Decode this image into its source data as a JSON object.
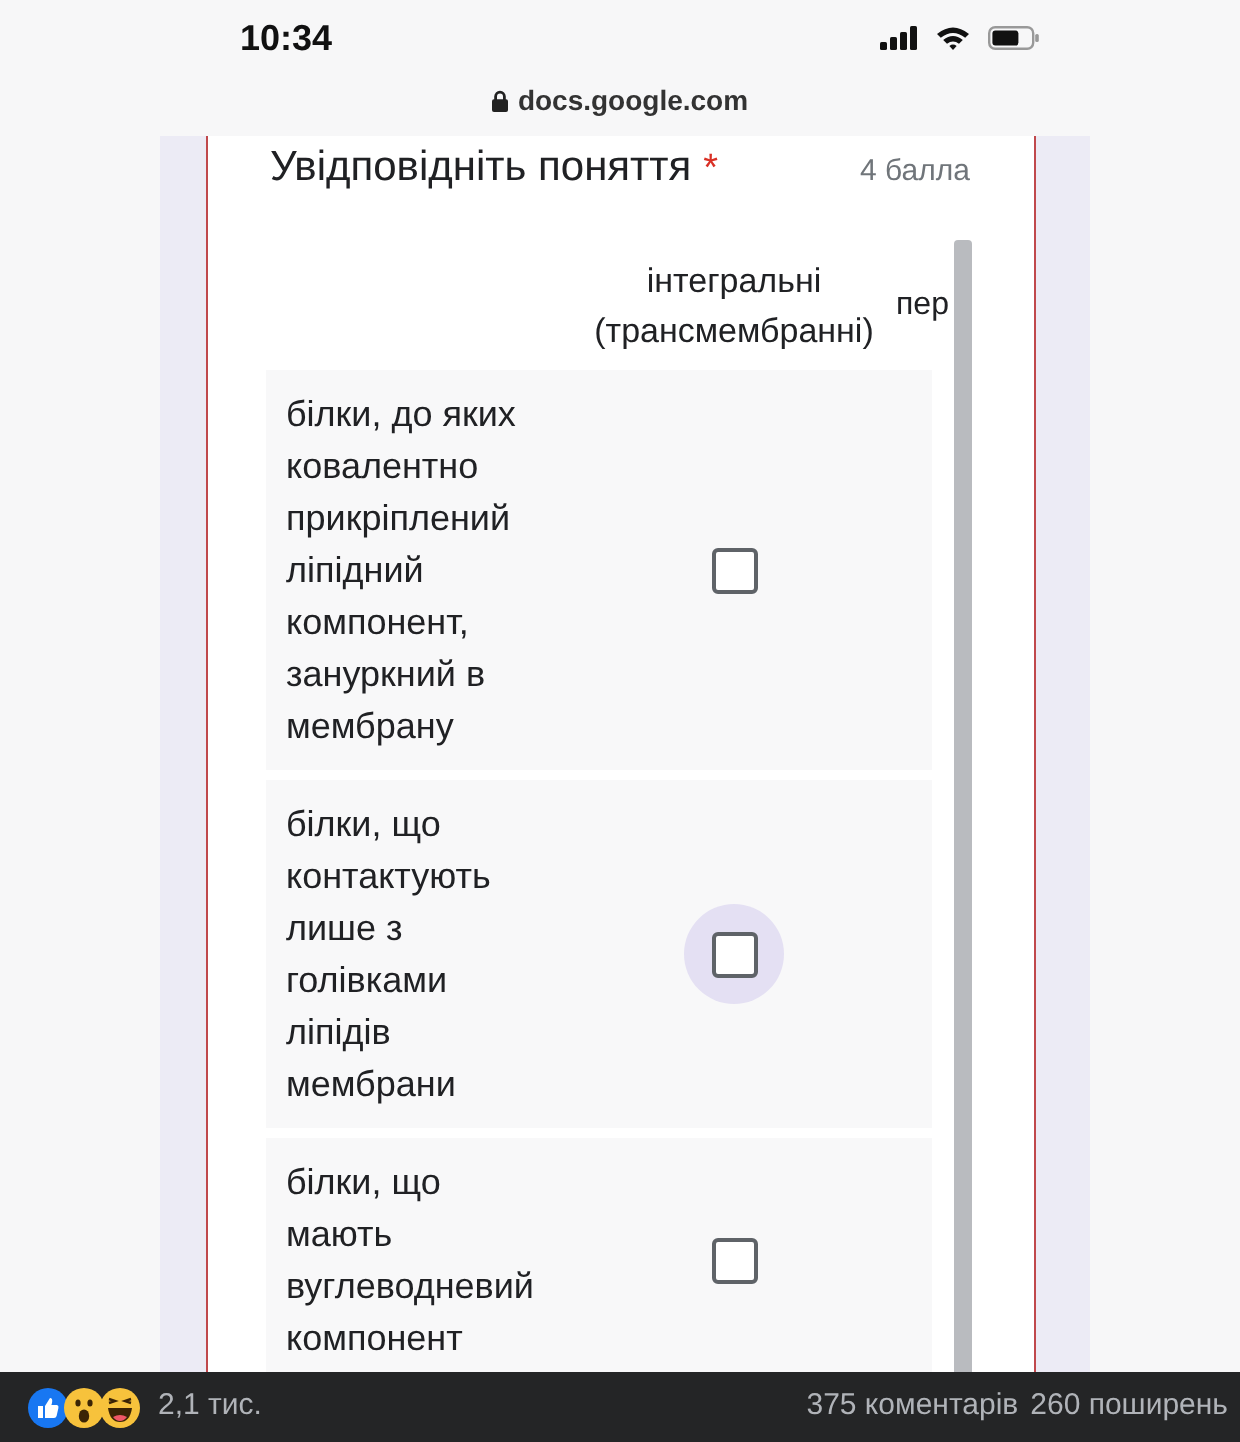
{
  "status_bar": {
    "time": "10:34"
  },
  "address_bar": {
    "url": "docs.google.com"
  },
  "question": {
    "title": "Увідповідніть поняття",
    "required_mark": "*",
    "points": "4 балла"
  },
  "grid": {
    "columns": [
      "інтегральні (трансмембранні)",
      "пер"
    ],
    "rows": [
      {
        "label": "білки, до яких ковалентно прикріплений ліпідний компонент, зануркний в мембрану",
        "checked": false,
        "focused": false
      },
      {
        "label": "білки, що контактують лише з голівками ліпідів мембрани",
        "checked": false,
        "focused": true
      },
      {
        "label": "білки, що мають вуглеводневий компонент",
        "checked": false,
        "focused": false
      }
    ]
  },
  "post_footer": {
    "reactions_count": "2,1 тис.",
    "comments": "375 коментарів",
    "shares": "260 поширень"
  }
}
